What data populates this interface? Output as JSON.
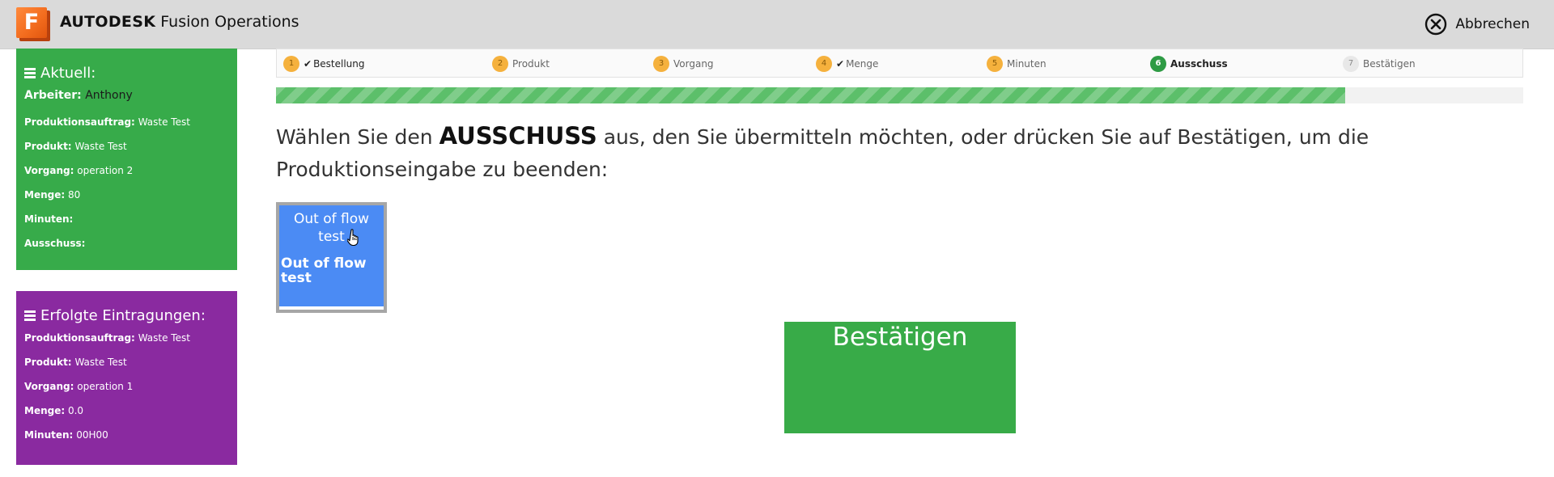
{
  "header": {
    "brand_bold": "AUTODESK",
    "brand_rest": "Fusion Operations",
    "logo_letter": "F",
    "cancel_label": "Abbrechen"
  },
  "current": {
    "title": "Aktuell:",
    "worker_label": "Arbeiter:",
    "worker_value": "Anthony",
    "rows": [
      {
        "label": "Produktionsauftrag:",
        "value": "Waste Test"
      },
      {
        "label": "Produkt:",
        "value": "Waste Test"
      },
      {
        "label": "Vorgang:",
        "value": "operation 2"
      },
      {
        "label": "Menge:",
        "value": "80"
      },
      {
        "label": "Minuten:",
        "value": ""
      },
      {
        "label": "Ausschuss:",
        "value": ""
      }
    ]
  },
  "completed": {
    "title": "Erfolgte Eintragungen:",
    "rows": [
      {
        "label": "Produktionsauftrag:",
        "value": "Waste Test"
      },
      {
        "label": "Produkt:",
        "value": "Waste Test"
      },
      {
        "label": "Vorgang:",
        "value": "operation 1"
      },
      {
        "label": "Menge:",
        "value": "0.0"
      },
      {
        "label": "Minuten:",
        "value": "00H00"
      }
    ]
  },
  "steps": [
    {
      "num": "1",
      "label": "Bestellung",
      "checked": true,
      "state": "done"
    },
    {
      "num": "2",
      "label": "Produkt",
      "checked": false,
      "state": "done"
    },
    {
      "num": "3",
      "label": "Vorgang",
      "checked": false,
      "state": "done"
    },
    {
      "num": "4",
      "label": "Menge",
      "checked": true,
      "state": "done"
    },
    {
      "num": "5",
      "label": "Minuten",
      "checked": false,
      "state": "done"
    },
    {
      "num": "6",
      "label": "Ausschuss",
      "checked": false,
      "state": "active"
    },
    {
      "num": "7",
      "label": "Bestätigen",
      "checked": false,
      "state": "pending"
    }
  ],
  "progress": {
    "fraction": 0.857
  },
  "instruction": {
    "before": "Wählen Sie den ",
    "keyword": "AUSSCHUSS",
    "after": " aus, den Sie übermitteln möchten, oder drücken Sie auf Bestätigen, um die Produktionseingabe zu beenden:"
  },
  "scrap_item": {
    "title": "Out of flow test",
    "subtitle": "Out of flow test"
  },
  "confirm_label": "Bestätigen",
  "colors": {
    "current_panel": "#37ab4a",
    "completed_panel": "#8a2aa0",
    "scrap_tile": "#4b8bf4",
    "confirm_button": "#38ab48",
    "step_done": "#f5b13d",
    "step_active": "#2e9b44"
  }
}
